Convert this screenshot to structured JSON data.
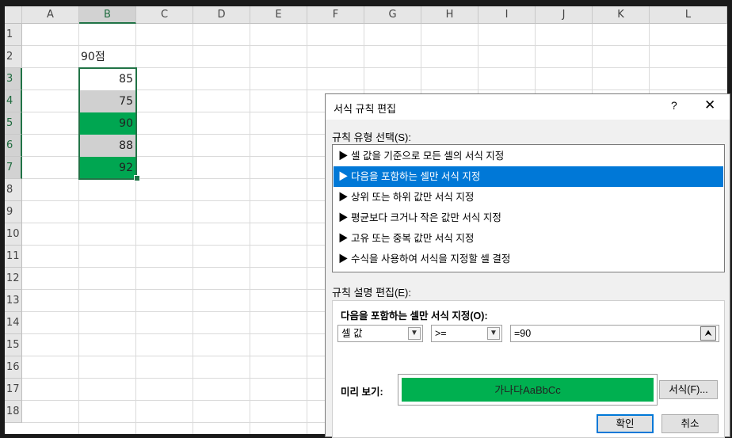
{
  "spreadsheet": {
    "columns": [
      "A",
      "B",
      "C",
      "D",
      "E",
      "F",
      "G",
      "H",
      "I",
      "J",
      "K",
      "L"
    ],
    "rows": [
      "1",
      "2",
      "3",
      "4",
      "5",
      "6",
      "7",
      "8",
      "9",
      "10",
      "11",
      "12",
      "13",
      "14",
      "15",
      "16",
      "17",
      "18"
    ],
    "b2_header": "90점",
    "values": [
      "85",
      "75",
      "90",
      "88",
      "92"
    ],
    "value_fills": [
      "none",
      "gray",
      "green",
      "gray",
      "green"
    ],
    "colors": {
      "green_fill": "#00a651",
      "gray_fill": "#d0d0d0",
      "selection": "#217346"
    }
  },
  "dialog": {
    "title": "서식 규칙 편집",
    "help_label": "?",
    "close_label": "✕",
    "rule_type_label": "규칙 유형 선택(S):",
    "rule_types": [
      "▶ 셀 값을 기준으로 모든 셀의 서식 지정",
      "▶ 다음을 포함하는 셀만 서식 지정",
      "▶ 상위 또는 하위 값만 서식 지정",
      "▶ 평균보다 크거나 작은 값만 서식 지정",
      "▶ 고유 또는 중복 값만 서식 지정",
      "▶ 수식을 사용하여 서식을 지정할 셀 결정"
    ],
    "selected_index": 1,
    "desc_label": "규칙 설명 편집(E):",
    "desc_heading": "다음을 포함하는 셀만 서식 지정(O):",
    "condition_type": "셀 값",
    "operator": ">=",
    "value": "=90",
    "preview_label": "미리 보기:",
    "preview_text": "가나다AaBbCc",
    "preview_color": "#00b050",
    "format_button": "서식(F)...",
    "ok_button": "확인",
    "cancel_button": "취소"
  }
}
